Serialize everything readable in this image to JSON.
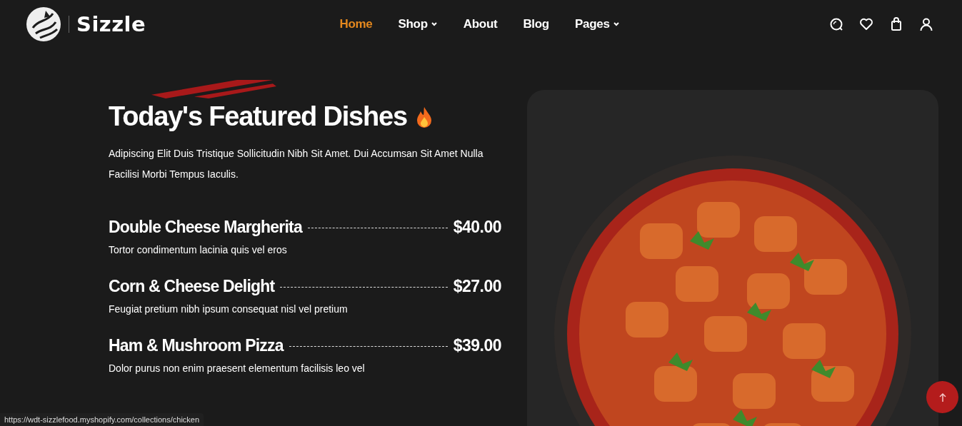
{
  "brand": {
    "name": "Sizzle"
  },
  "nav": [
    {
      "label": "Home",
      "selected": true,
      "dropdown": false
    },
    {
      "label": "Shop",
      "selected": false,
      "dropdown": true
    },
    {
      "label": "About",
      "selected": false,
      "dropdown": false
    },
    {
      "label": "Blog",
      "selected": false,
      "dropdown": false
    },
    {
      "label": "Pages",
      "selected": false,
      "dropdown": true
    }
  ],
  "featured": {
    "title": "Today's Featured Dishes",
    "intro": "Adipiscing Elit Duis Tristique Sollicitudin Nibh Sit Amet. Dui Accumsan Sit Amet Nulla Facilisi Morbi Tempus Iaculis.",
    "dishes": [
      {
        "name": "Double Cheese Margherita",
        "price": "$40.00",
        "description": "Tortor condimentum lacinia quis vel eros"
      },
      {
        "name": "Corn & Cheese Delight",
        "price": "$27.00",
        "description": "Feugiat pretium nibh ipsum consequat nisl vel pretium"
      },
      {
        "name": "Ham & Mushroom Pizza",
        "price": "$39.00",
        "description": "Dolor purus non enim praesent elementum facilisis leo vel"
      }
    ]
  },
  "status_bar": {
    "url": "https://wdt-sizzlefood.myshopify.com/collections/chicken"
  }
}
